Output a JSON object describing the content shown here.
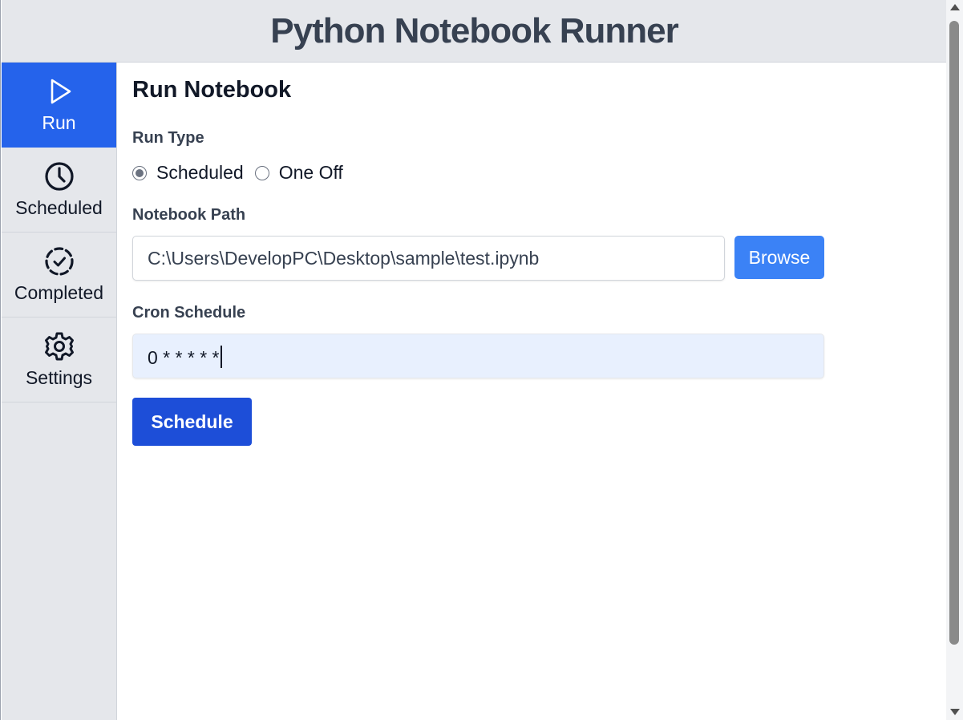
{
  "app": {
    "title": "Python Notebook Runner"
  },
  "sidebar": {
    "items": [
      {
        "label": "Run",
        "icon": "play-icon",
        "active": true
      },
      {
        "label": "Scheduled",
        "icon": "clock-icon",
        "active": false
      },
      {
        "label": "Completed",
        "icon": "dashed-check-circle-icon",
        "active": false
      },
      {
        "label": "Settings",
        "icon": "gear-icon",
        "active": false
      }
    ]
  },
  "main": {
    "title": "Run Notebook",
    "run_type": {
      "label": "Run Type",
      "options": [
        {
          "label": "Scheduled",
          "checked": true
        },
        {
          "label": "One Off",
          "checked": false
        }
      ]
    },
    "notebook_path": {
      "label": "Notebook Path",
      "value": "C:\\Users\\DevelopPC\\Desktop\\sample\\test.ipynb",
      "browse_label": "Browse"
    },
    "cron": {
      "label": "Cron Schedule",
      "value": "0 * * * * *"
    },
    "submit_label": "Schedule"
  },
  "colors": {
    "accent": "#2563eb",
    "browse_button": "#3b82f6",
    "schedule_button": "#1d4ed8",
    "sidebar_bg": "#e5e7eb",
    "autofill_bg": "#e8f0fe"
  }
}
